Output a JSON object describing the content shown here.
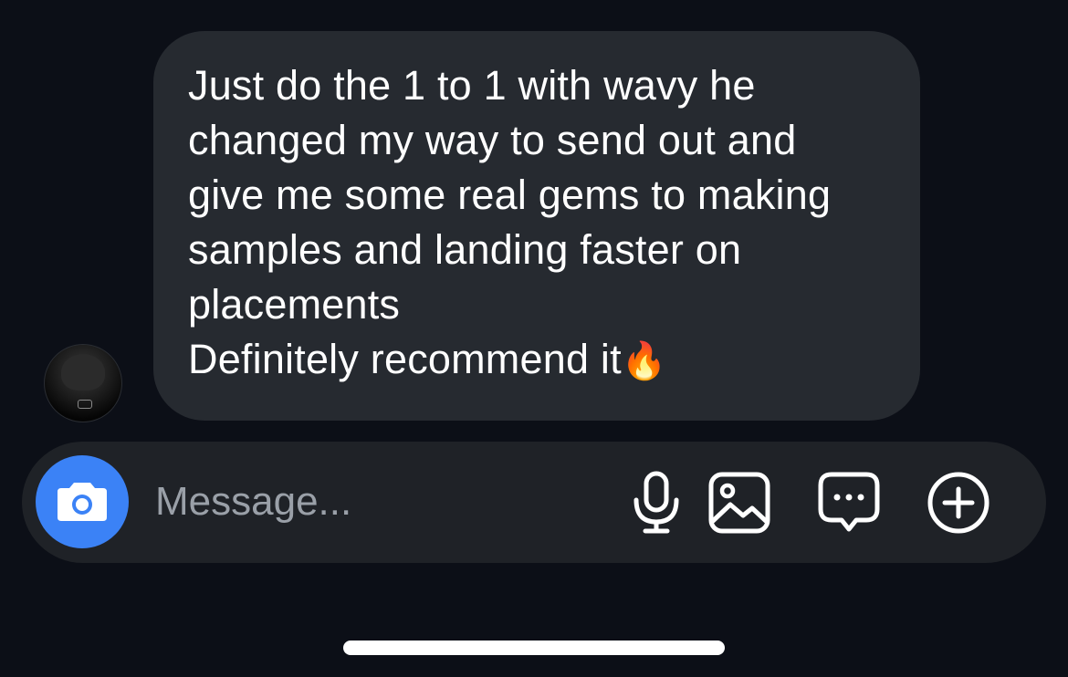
{
  "conversation": {
    "message": {
      "text": "Just do the 1 to 1 with wavy he\nchanged my way to send out and\ngive me some real gems to making\nsamples and landing faster on\nplacements\nDefinitely recommend it",
      "emoji": "🔥"
    },
    "sender_avatar": "user-avatar"
  },
  "composer": {
    "placeholder": "Message...",
    "icons": {
      "camera": "camera-icon",
      "microphone": "microphone-icon",
      "gallery": "image-icon",
      "sticker": "message-bubble-icon",
      "more": "plus-circle-icon"
    },
    "accent_color": "#3b82f6"
  },
  "theme": {
    "background": "#0c0f17",
    "bubble": "#262a30",
    "composer": "#1f2227"
  }
}
